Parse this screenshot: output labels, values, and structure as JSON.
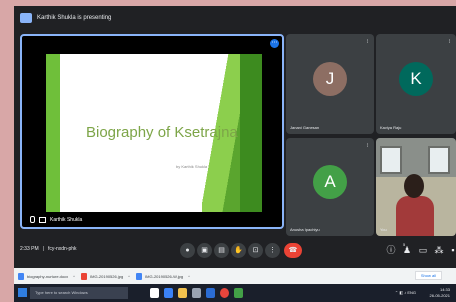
{
  "meet": {
    "presenter_banner": "Karthik Shukla is presenting",
    "main_tile_name": "Karthik Shukla",
    "time": "2:33 PM",
    "separator": "|",
    "meeting_code": "fcy-nxdn-phk"
  },
  "slide": {
    "title": "Biography of Ksetrajna",
    "byline": "by Karthik Shukla"
  },
  "participants": [
    {
      "initial": "J",
      "name": "Janani Ganesan",
      "color": "#8d6e63"
    },
    {
      "initial": "K",
      "name": "Kaviya Raju",
      "color": "#00695c"
    },
    {
      "initial": "A",
      "name": "Anusha Ipachiyu",
      "color": "#43a047"
    },
    {
      "initial": "",
      "name": "You",
      "color": ""
    }
  ],
  "controls": {
    "mic_icon": "mic-icon",
    "camera_icon": "camera-icon",
    "captions_icon": "captions-icon",
    "hand_icon": "raise-hand-icon",
    "present_icon": "present-icon",
    "more_icon": "more-vert-icon",
    "leave_icon": "call-end-icon",
    "people_count": "5"
  },
  "downloads": {
    "items": [
      {
        "name": "biography-nurture.docx"
      },
      {
        "name": "IMG-20190526.jpg"
      },
      {
        "name": "IMG-20190526-W.jpg"
      }
    ],
    "show_all": "Show all"
  },
  "taskbar": {
    "search_placeholder": "Type here to search Windows",
    "time": "14:33",
    "date": "26-05-2021"
  },
  "colors": {
    "accent": "#8ab4f8",
    "leave": "#ea4335",
    "slide_green": "#6fbf3a"
  }
}
